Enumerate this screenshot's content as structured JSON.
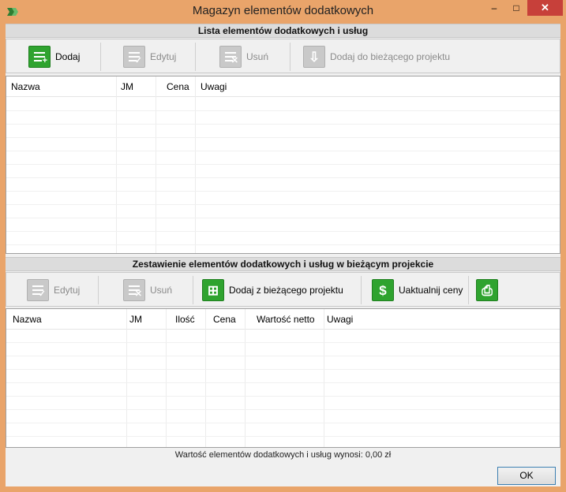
{
  "window": {
    "title": "Magazyn elementów dodatkowych",
    "min_icon": "minimize-icon",
    "max_icon": "maximize-icon",
    "close_icon": "close-icon",
    "min_glyph": "–",
    "max_glyph": "□",
    "close_glyph": "✕"
  },
  "top_section": {
    "header": "Lista elementów dodatkowych i usług",
    "toolbar": {
      "add": "Dodaj",
      "edit": "Edytuj",
      "delete": "Usuń",
      "add_to_project": "Dodaj do bieżącego projektu"
    },
    "columns": [
      "Nazwa",
      "JM",
      "Cena",
      "Uwagi"
    ],
    "rows": []
  },
  "bottom_section": {
    "header": "Zestawienie elementów dodatkowych i usług w bieżącym projekcie",
    "toolbar": {
      "edit": "Edytuj",
      "delete": "Usuń",
      "add_from_project": "Dodaj z bieżącego projektu",
      "update_prices": "Uaktualnij ceny",
      "print_icon": "printer-icon"
    },
    "columns": [
      "Nazwa",
      "JM",
      "Ilość",
      "Cena",
      "Wartość netto",
      "Uwagi"
    ],
    "rows": []
  },
  "summary": "Wartość elementów dodatkowych i usług wynosi: 0,00 zł",
  "ok_button": "OK",
  "colors": {
    "title_bar": "#e9a46a",
    "close_button": "#c7403a",
    "accent_green": "#2fa32f",
    "disabled_gray": "#c9c9c9"
  }
}
